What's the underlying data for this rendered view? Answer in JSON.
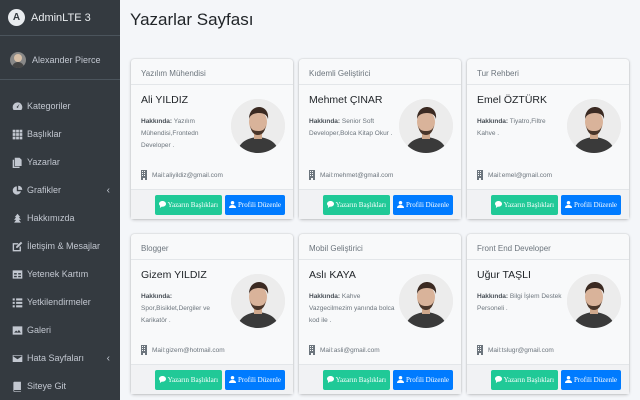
{
  "app": {
    "title": "AdminLTE 3",
    "logo_letter": "A"
  },
  "user": {
    "name": "Alexander Pierce"
  },
  "nav": [
    {
      "label": "Kategoriler",
      "icon": "tachometer-icon",
      "caret": false
    },
    {
      "label": "Başlıklar",
      "icon": "grid-icon",
      "caret": false
    },
    {
      "label": "Yazarlar",
      "icon": "copy-icon",
      "caret": false
    },
    {
      "label": "Grafikler",
      "icon": "pie-chart-icon",
      "caret": true
    },
    {
      "label": "Hakkımızda",
      "icon": "tree-icon",
      "caret": false
    },
    {
      "label": "İletişim & Mesajlar",
      "icon": "edit-icon",
      "caret": false
    },
    {
      "label": "Yetenek Kartım",
      "icon": "table-icon",
      "caret": false
    },
    {
      "label": "Yetkilendirmeler",
      "icon": "list-icon",
      "caret": false
    },
    {
      "label": "Galeri",
      "icon": "image-icon",
      "caret": false
    },
    {
      "label": "Hata Sayfaları",
      "icon": "envelope-icon",
      "caret": true
    },
    {
      "label": "Siteye Git",
      "icon": "book-icon",
      "caret": false
    }
  ],
  "page": {
    "title": "Yazarlar Sayfası"
  },
  "labels": {
    "about": "Hakkında:",
    "mail_prefix": "Mail: ",
    "btn_posts": "Yazarın Başlıkları",
    "btn_profile": "Profili Düzenle"
  },
  "cards": [
    {
      "role": "Yazılım Mühendisi",
      "name": "Ali YILDIZ",
      "about": "Yazılım Mühendisi,Frontedn Developer .",
      "mail": "aliyildiz@gmail.com"
    },
    {
      "role": "Kıdemli Geliştirici",
      "name": "Mehmet ÇINAR",
      "about": "Senior Soft Developer,Bolca Kitap Okur .",
      "mail": "mehmet@gmail.com"
    },
    {
      "role": "Tur Rehberi",
      "name": "Emel ÖZTÜRK",
      "about": "Tiyatro,Filtre Kahve .",
      "mail": "emel@gmail.com"
    },
    {
      "role": "Blogger",
      "name": "Gizem YILDIZ",
      "about": "Spor,Bisiklet,Dergiler ve Karikatör .",
      "mail": "gizem@hotmail.com"
    },
    {
      "role": "Mobil Geliştirici",
      "name": "Aslı KAYA",
      "about": "Kahve Vazgecilmezim yanında bolca kod ile .",
      "mail": "asli@gmail.com"
    },
    {
      "role": "Front End Developer",
      "name": "Uğur TAŞLI",
      "about": "Bilgi İşlem Destek Personeli .",
      "mail": "tslugr@gmail.com"
    }
  ],
  "colors": {
    "sidebar_bg": "#343a40",
    "btn_green": "#20c997",
    "btn_blue": "#007bff"
  }
}
